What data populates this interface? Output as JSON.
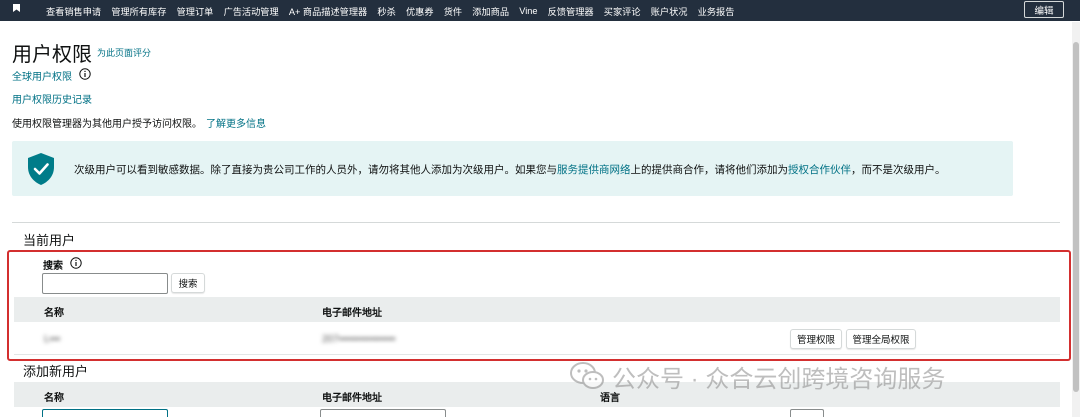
{
  "nav": {
    "items": [
      "查看销售申请",
      "管理所有库存",
      "管理订单",
      "广告活动管理",
      "A+ 商品描述管理器",
      "秒杀",
      "优惠券",
      "货件",
      "添加商品",
      "Vine",
      "反馈管理器",
      "买家评论",
      "账户状况",
      "业务报告"
    ],
    "edit_label": "编辑"
  },
  "page": {
    "title": "用户权限",
    "rate_link": "为此页面评分",
    "global_link": "全球用户权限",
    "history_link": "用户权限历史记录",
    "description": "使用权限管理器为其他用户授予访问权限。",
    "learn_more": "了解更多信息"
  },
  "banner": {
    "text_1": "次级用户可以看到敏感数据。除了直接为贵公司工作的人员外，请勿将其他人添加为次级用户。如果您与",
    "link_1": "服务提供商网络",
    "text_2": "上的提供商合作，请将他们添加为",
    "link_2": "授权合作伙伴",
    "text_3": "，而不是次级用户。"
  },
  "current_users": {
    "title": "当前用户",
    "search_label": "搜索",
    "search_value": "",
    "search_button": "搜索",
    "columns": [
      "名称",
      "电子邮件地址"
    ],
    "rows": [
      {
        "name": "L▪▪▪",
        "email": "207▪▪▪▪▪▪▪▪▪▪▪▪▪▪▪▪",
        "buttons": [
          "管理权限",
          "管理全局权限"
        ]
      }
    ]
  },
  "add_user": {
    "title": "添加新用户",
    "columns": [
      "名称",
      "电子邮件地址",
      "语言"
    ]
  },
  "watermark": "公众号 · 众合云创跨境咨询服务",
  "colors": {
    "nav_bg": "#232f3e",
    "link": "#007185",
    "banner_bg": "#e5f4f4",
    "highlight_box": "#d32f2f"
  }
}
